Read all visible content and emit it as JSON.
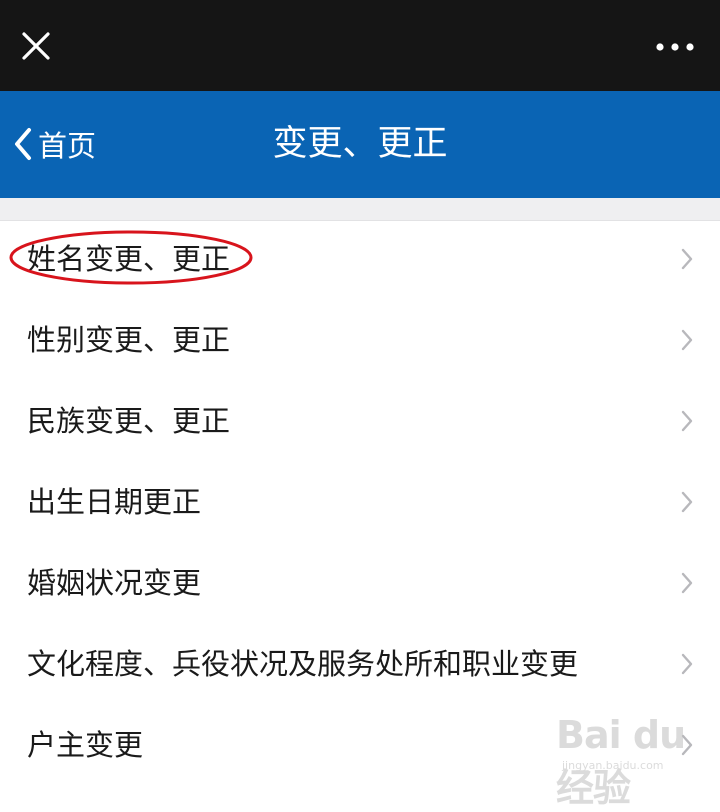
{
  "navbar": {
    "back_label": "首页",
    "title": "变更、更正"
  },
  "list": {
    "items": [
      {
        "label": "姓名变更、更正"
      },
      {
        "label": "性别变更、更正"
      },
      {
        "label": "民族变更、更正"
      },
      {
        "label": "出生日期更正"
      },
      {
        "label": "婚姻状况变更"
      },
      {
        "label": "文化程度、兵役状况及服务处所和职业变更"
      },
      {
        "label": "户主变更"
      }
    ]
  },
  "annotation": {
    "highlighted_item": "姓名变更、更正",
    "ring_color": "#d8141c"
  },
  "watermark": {
    "brand": "Bai du 经验",
    "url": "jingyan.baidu.com"
  },
  "colors": {
    "topbar_bg": "#151515",
    "navbar_bg": "#0a64b4",
    "separator_bg": "#efeff1",
    "chevron": "#b8b8bc"
  },
  "icons": {
    "close": "close-icon",
    "more": "more-dots-icon",
    "back": "chevron-left-icon",
    "row": "chevron-right-icon"
  }
}
